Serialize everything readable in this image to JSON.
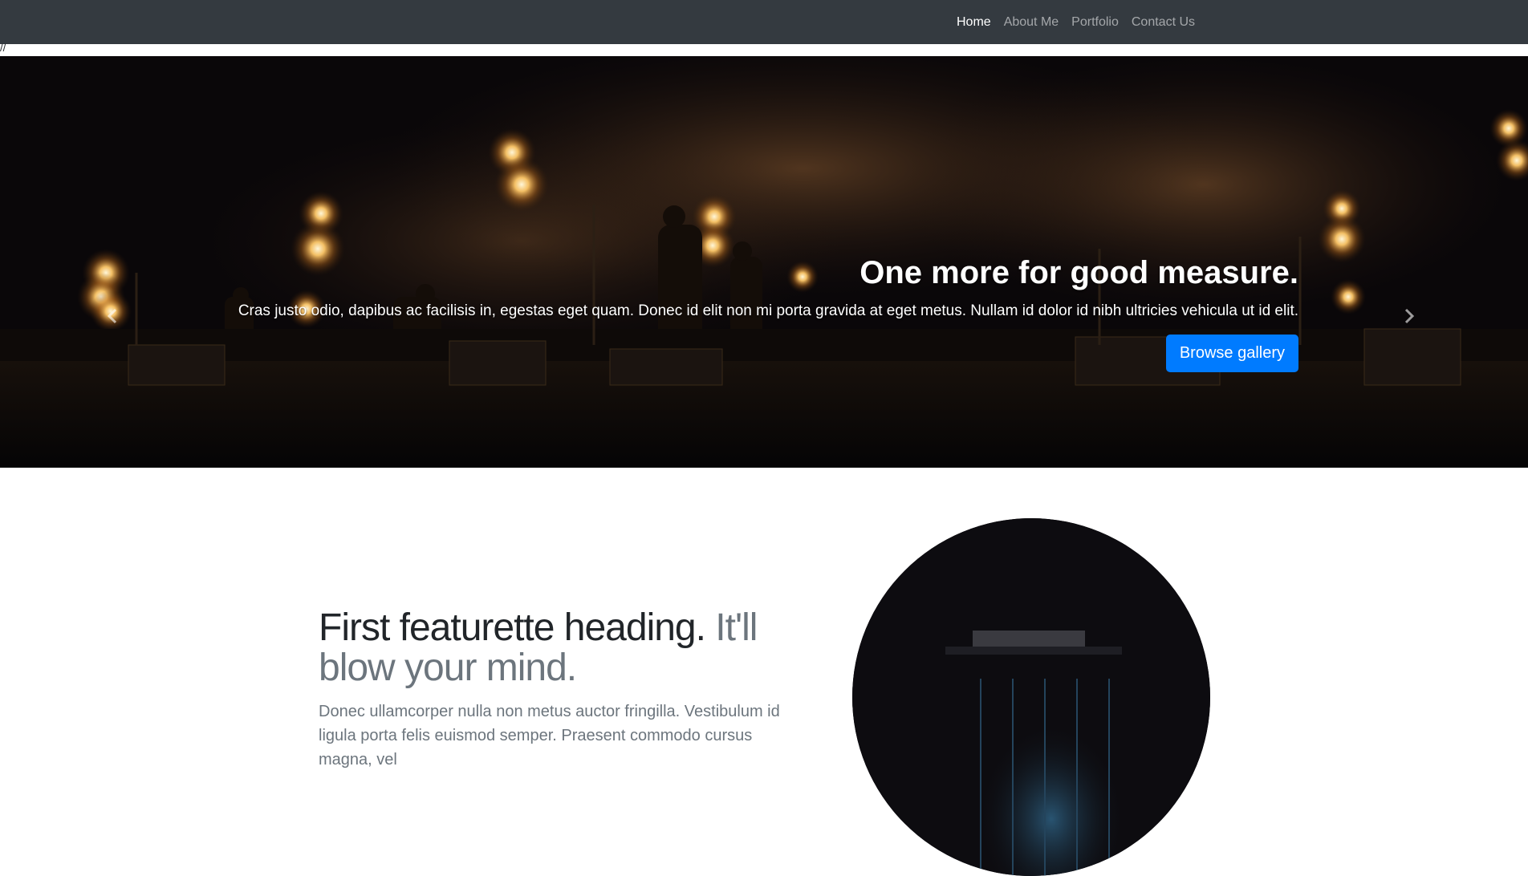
{
  "nav": {
    "items": [
      {
        "label": "Home",
        "active": true
      },
      {
        "label": "About Me",
        "active": false
      },
      {
        "label": "Portfolio",
        "active": false
      },
      {
        "label": "Contact Us",
        "active": false
      }
    ]
  },
  "stray_text": "//",
  "carousel": {
    "slide": {
      "heading": "One more for good measure.",
      "text": "Cras justo odio, dapibus ac facilisis in, egestas eget quam. Donec id elit non mi porta gravida at eget metus. Nullam id dolor id nibh ultricies vehicula ut id elit.",
      "button_label": "Browse gallery"
    },
    "prev_icon": "chevron-left-icon",
    "next_icon": "chevron-right-icon",
    "indicators": [
      false,
      false,
      true
    ]
  },
  "featurette": {
    "heading": "First featurette heading.",
    "heading_muted": "It'll blow your mind.",
    "lead": "Donec ullamcorper nulla non metus auctor fringilla. Vestibulum id ligula porta felis euismod semper. Praesent commodo cursus magna, vel"
  },
  "colors": {
    "navbar": "#343a40",
    "primary": "#007bff",
    "text_dark": "#212529",
    "text_muted": "#6c757d"
  }
}
